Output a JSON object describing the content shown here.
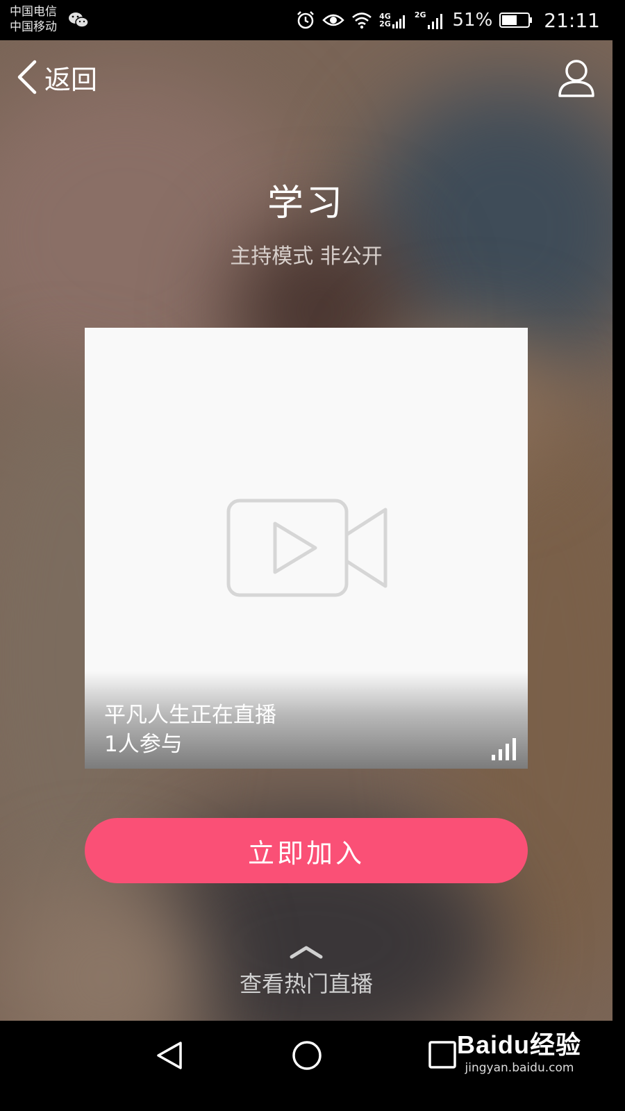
{
  "status_bar": {
    "carrier_1": "中国电信",
    "carrier_2": "中国移动",
    "net_1": "4G",
    "net_2": "2G",
    "net_3": "2G",
    "battery": "51%",
    "time": "21:11"
  },
  "header": {
    "back_label": "返回"
  },
  "room": {
    "title": "学习",
    "subtitle": "主持模式 非公开"
  },
  "card": {
    "host_line": "平凡人生正在直播",
    "participants": "1人参与"
  },
  "join_button": "立即加入",
  "hot_link": "查看热门直播",
  "watermark": {
    "brand": "Baidu经验",
    "url": "jingyan.baidu.com"
  },
  "colors": {
    "accent": "#fa5076",
    "card_bg": "#f9f9f9"
  },
  "icons": [
    "wechat-icon",
    "alarm-icon",
    "eye-icon",
    "wifi-icon",
    "signal-icon",
    "battery-icon",
    "chevron-left-icon",
    "user-icon",
    "video-camera-icon",
    "signal-bars-icon",
    "chevron-up-icon",
    "nav-back-icon",
    "nav-home-icon",
    "nav-recent-icon"
  ]
}
